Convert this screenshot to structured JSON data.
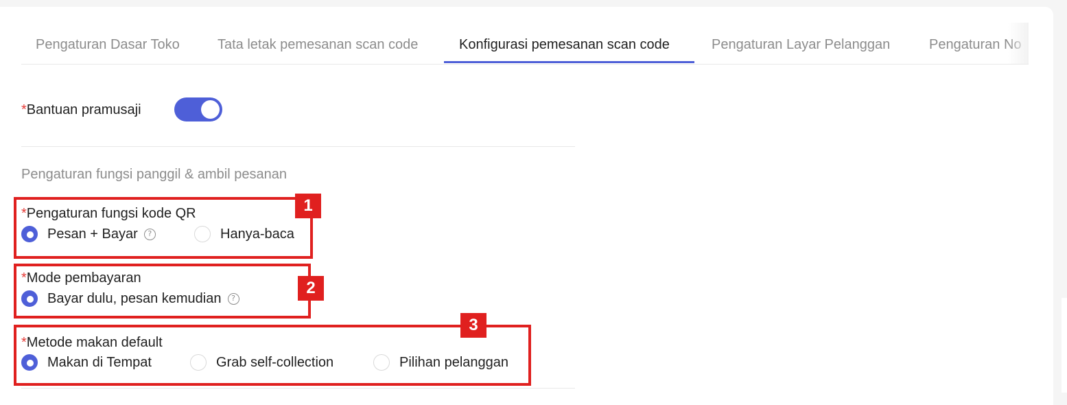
{
  "tabs": [
    {
      "label": "Pengaturan Dasar Toko",
      "active": false
    },
    {
      "label": "Tata letak pemesanan scan code",
      "active": false
    },
    {
      "label": "Konfigurasi pemesanan scan code",
      "active": true
    },
    {
      "label": "Pengaturan Layar Pelanggan",
      "active": false
    },
    {
      "label": "Pengaturan No",
      "active": false
    }
  ],
  "waiter_assist": {
    "required_mark": "*",
    "label": "Bantuan pramusaji",
    "enabled": true
  },
  "section_title": "Pengaturan fungsi panggil & ambil pesanan",
  "qr_function": {
    "required_mark": "*",
    "label": "Pengaturan fungsi kode QR",
    "options": [
      {
        "label": "Pesan + Bayar",
        "checked": true
      },
      {
        "label": "Hanya-baca",
        "checked": false
      }
    ],
    "help_icon": "?"
  },
  "payment_mode": {
    "required_mark": "*",
    "label": "Mode pembayaran",
    "options": [
      {
        "label": "Bayar dulu, pesan kemudian",
        "checked": true
      }
    ],
    "help_icon": "?"
  },
  "dining_method": {
    "required_mark": "*",
    "label": "Metode makan default",
    "options": [
      {
        "label": "Makan di Tempat",
        "checked": true
      },
      {
        "label": "Grab self-collection",
        "checked": false
      },
      {
        "label": "Pilihan pelanggan",
        "checked": false
      }
    ]
  },
  "annotations": [
    "1",
    "2",
    "3"
  ],
  "colors": {
    "accent": "#4e5fd8",
    "required": "#e53935",
    "highlight": "#e0201f"
  }
}
